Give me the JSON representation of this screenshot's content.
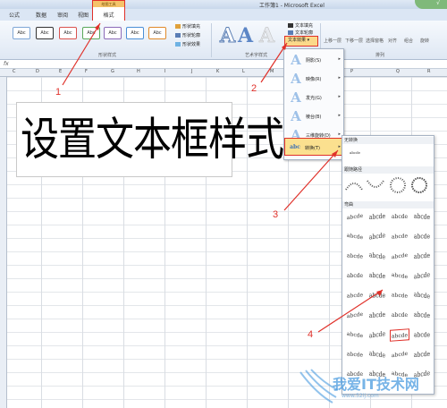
{
  "window": {
    "title": "工作簿1 - Microsoft Excel",
    "control": "√"
  },
  "tabs": [
    "公式",
    "数据",
    "审阅",
    "视图"
  ],
  "context_tab": {
    "header": "绘图工具",
    "name": "格式"
  },
  "shape_styles": {
    "swatch_label": "Abc",
    "group_label": "形状样式",
    "fill": "形状填充",
    "outline": "形状轮廓",
    "effects": "形状效果"
  },
  "wordart": {
    "glyph": "A",
    "group_label": "艺术字样式",
    "fill": "文本填充",
    "outline": "文本轮廓",
    "effects": "文本效果"
  },
  "arrange": {
    "items": [
      "上移一层",
      "下移一层",
      "选择窗格",
      "对齐",
      "组合",
      "旋转"
    ],
    "group_label": "排列"
  },
  "formula_bar": {
    "fx": "fx"
  },
  "columns": [
    "C",
    "D",
    "E",
    "F",
    "G",
    "H",
    "I",
    "J",
    "K",
    "L",
    "M",
    "N",
    "O",
    "P",
    "Q",
    "R"
  ],
  "textbox_text": "设置文本框样式",
  "effects_menu": {
    "items": [
      {
        "label": "阴影(S)",
        "icon": "A"
      },
      {
        "label": "映像(R)",
        "icon": "A"
      },
      {
        "label": "发光(G)",
        "icon": "A"
      },
      {
        "label": "棱台(B)",
        "icon": "A"
      },
      {
        "label": "三维旋转(D)",
        "icon": "A"
      },
      {
        "label": "转换(T)",
        "icon": "abc"
      }
    ]
  },
  "gallery": {
    "sections": [
      "无转换",
      "跟随路径",
      "弯曲"
    ],
    "no_transform_sample": "abcde",
    "cell_text": "abcde"
  },
  "annotations": [
    "1",
    "2",
    "3",
    "4"
  ],
  "watermark": {
    "text": "我爱IT技术网",
    "sub": "www.52ij.com"
  },
  "colors": {
    "annotation": "#e0312a",
    "highlight": "#fbe08f",
    "accent": "#4a9be0"
  }
}
